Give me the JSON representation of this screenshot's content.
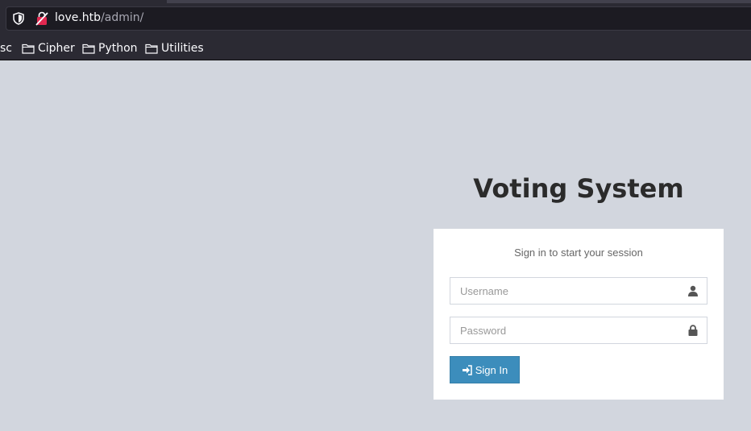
{
  "browser": {
    "url_host": "love.htb",
    "url_path": "/admin/",
    "bookmarks": [
      {
        "label": "sc"
      },
      {
        "label": "Cipher"
      },
      {
        "label": "Python"
      },
      {
        "label": "Utilities"
      }
    ]
  },
  "login": {
    "title": "Voting System",
    "message": "Sign in to start your session",
    "username_placeholder": "Username",
    "password_placeholder": "Password",
    "signin_label": "Sign In"
  }
}
